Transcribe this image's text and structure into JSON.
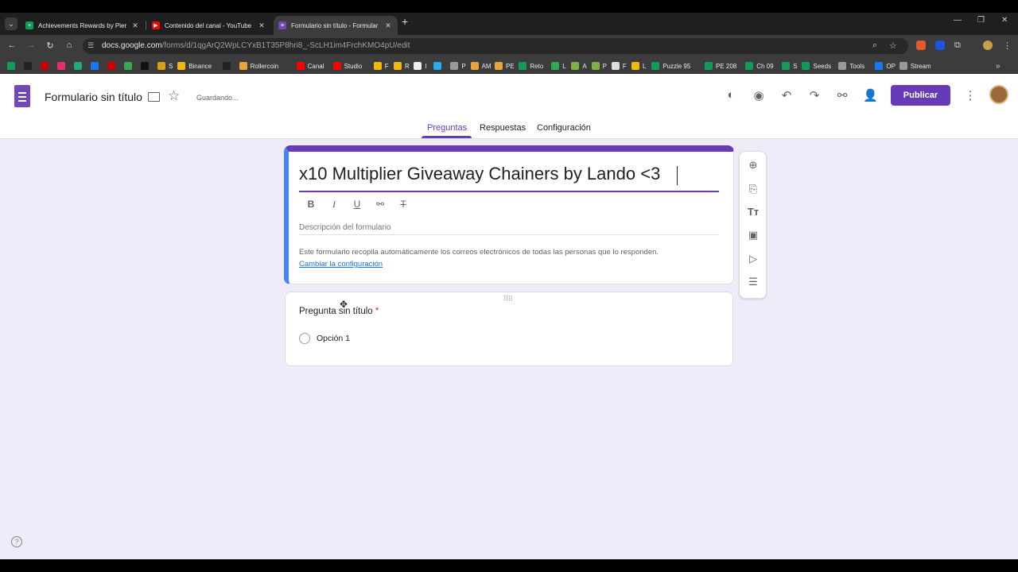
{
  "browser": {
    "tabs": [
      {
        "title": "Achievements Rewards by Pier",
        "favicon": "sheets-icon",
        "color": "#0f9d58"
      },
      {
        "title": "Contenido del canal - YouTube",
        "favicon": "youtube-icon",
        "color": "#ff0000"
      },
      {
        "title": "Formulario sin título - Formular",
        "favicon": "forms-icon",
        "color": "#7248b9"
      }
    ],
    "url": {
      "host": "docs.google.com",
      "path": "/forms/d/1qgArQ2WpLCYxB1T35P8hri8_-ScLH1im4FrchKMO4pU/edit"
    },
    "bookmarks": [
      {
        "label": "",
        "color": "#0f9d58"
      },
      {
        "label": "",
        "color": "#222"
      },
      {
        "label": "",
        "color": "#c00"
      },
      {
        "label": "",
        "color": "#e1306c"
      },
      {
        "label": "",
        "color": "#2a7"
      },
      {
        "label": "",
        "color": "#1877f2"
      },
      {
        "label": "",
        "color": "#c00"
      },
      {
        "label": "",
        "color": "#34a853"
      },
      {
        "label": "",
        "color": "#111"
      },
      {
        "label": "S",
        "color": "#d4a017"
      },
      {
        "label": "Binance",
        "color": "#f0b90b"
      },
      {
        "label": "",
        "color": "#222"
      },
      {
        "label": "Rollercoin",
        "color": "#e8a33c"
      },
      {
        "label": "Canal",
        "color": "#ff0000"
      },
      {
        "label": "Studio",
        "color": "#ff0000"
      },
      {
        "label": "F",
        "color": "#f0b90b"
      },
      {
        "label": "R",
        "color": "#f0b90b"
      },
      {
        "label": "I",
        "color": "#eee"
      },
      {
        "label": "",
        "color": "#2aabee"
      },
      {
        "label": "P",
        "color": "#999"
      },
      {
        "label": "AM",
        "color": "#e8a33c"
      },
      {
        "label": "PE",
        "color": "#e8a33c"
      },
      {
        "label": "Reto",
        "color": "#0f9d58"
      },
      {
        "label": "L",
        "color": "#34a853"
      },
      {
        "label": "A",
        "color": "#7cb342"
      },
      {
        "label": "P",
        "color": "#7cb342"
      },
      {
        "label": "F",
        "color": "#ddd"
      },
      {
        "label": "L",
        "color": "#f0b90b"
      },
      {
        "label": "Puzzle 95",
        "color": "#0f9d58"
      },
      {
        "label": "PE 208",
        "color": "#0f9d58"
      },
      {
        "label": "Ch 09",
        "color": "#0f9d58"
      },
      {
        "label": "S",
        "color": "#0f9d58"
      },
      {
        "label": "Seeds",
        "color": "#0f9d58"
      },
      {
        "label": "Tools",
        "color": "#999"
      },
      {
        "label": "OP",
        "color": "#1877f2"
      },
      {
        "label": "Stream",
        "color": "#999"
      }
    ]
  },
  "header": {
    "doc_title": "Formulario sin título",
    "status": "Guardando...",
    "publish_label": "Publicar",
    "nav_tabs": [
      "Preguntas",
      "Respuestas",
      "Configuración"
    ]
  },
  "form": {
    "title": "x10 Multiplier Giveaway Chainers by Lando <3",
    "description_placeholder": "Descripción del formulario",
    "notice": "Este formulario recopila automáticamente los correos electrónicos de todas las personas que lo responden.",
    "notice_link": "Cambiar la configuración"
  },
  "question": {
    "title": "Pregunta sin título",
    "required_mark": "*",
    "option_label": "Opción 1"
  },
  "colors": {
    "accent": "#673ab7",
    "page_bg": "#f0ebf8",
    "link": "#1a73e8"
  }
}
